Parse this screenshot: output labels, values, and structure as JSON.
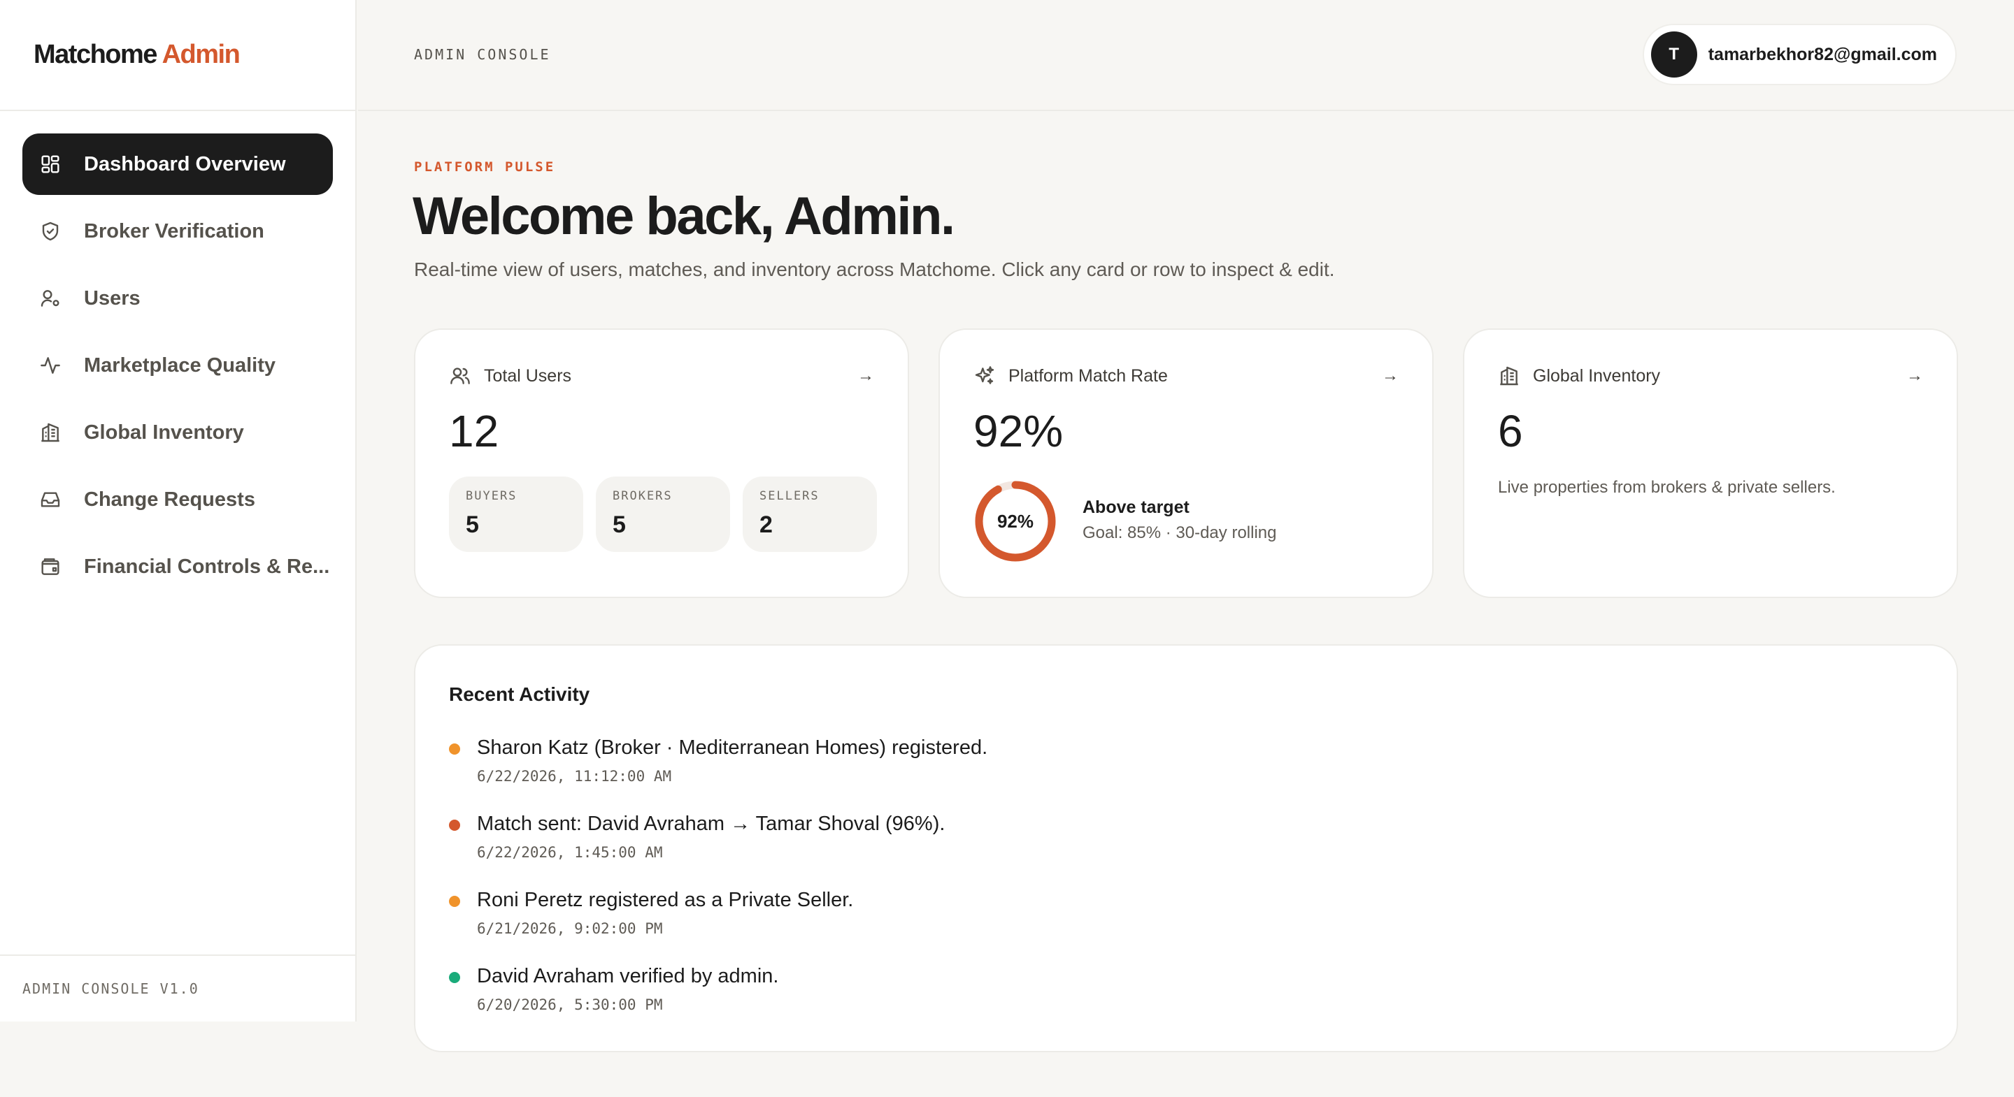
{
  "brand": {
    "name": "Matchome",
    "accent_word": "Admin",
    "accent_color": "#d4582d"
  },
  "sidebar": {
    "items": [
      {
        "label": "Dashboard Overview",
        "icon": "dashboard-grid-icon",
        "active": true
      },
      {
        "label": "Broker Verification",
        "icon": "shield-icon",
        "active": false
      },
      {
        "label": "Users",
        "icon": "user-gear-icon",
        "active": false
      },
      {
        "label": "Marketplace Quality",
        "icon": "activity-pulse-icon",
        "active": false
      },
      {
        "label": "Global Inventory",
        "icon": "building-icon",
        "active": false
      },
      {
        "label": "Change Requests",
        "icon": "inbox-icon",
        "active": false
      },
      {
        "label": "Financial Controls & Re...",
        "icon": "wallet-icon",
        "active": false
      }
    ],
    "footer": "ADMIN CONSOLE V1.0"
  },
  "topbar": {
    "crumb": "ADMIN CONSOLE",
    "user": {
      "initial": "T",
      "email": "tamarbekhor82@gmail.com"
    }
  },
  "hero": {
    "eyebrow": "PLATFORM PULSE",
    "title": "Welcome back, Admin.",
    "subtitle": "Real-time view of users, matches, and inventory across Matchome. Click any card or row to inspect & edit."
  },
  "cards": {
    "users": {
      "title": "Total Users",
      "icon": "users-icon",
      "arrow": "→",
      "value": "12",
      "breakdown": [
        {
          "label": "BUYERS",
          "value": "5"
        },
        {
          "label": "BROKERS",
          "value": "5"
        },
        {
          "label": "SELLERS",
          "value": "2"
        }
      ]
    },
    "match": {
      "title": "Platform Match Rate",
      "icon": "sparkles-icon",
      "arrow": "→",
      "value": "92%",
      "donut_percent": 92,
      "donut_label": "92%",
      "status": "Above target",
      "goal": "Goal: 85% · 30-day rolling",
      "ring_color": "#d4582d"
    },
    "inventory": {
      "title": "Global Inventory",
      "icon": "building-icon",
      "arrow": "→",
      "value": "6",
      "description": "Live properties from brokers & private sellers."
    }
  },
  "activity": {
    "title": "Recent Activity",
    "items": [
      {
        "text": "Sharon Katz (Broker · Mediterranean Homes) registered.",
        "time": "6/22/2026, 11:12:00 AM",
        "color": "#f0932b"
      },
      {
        "text": "Match sent: David Avraham → Tamar Shoval (96%).",
        "time": "6/22/2026, 1:45:00 AM",
        "color": "#d4582d"
      },
      {
        "text": "Roni Peretz registered as a Private Seller.",
        "time": "6/21/2026, 9:02:00 PM",
        "color": "#f0932b"
      },
      {
        "text": "David Avraham verified by admin.",
        "time": "6/20/2026, 5:30:00 PM",
        "color": "#1aab7a"
      }
    ]
  }
}
